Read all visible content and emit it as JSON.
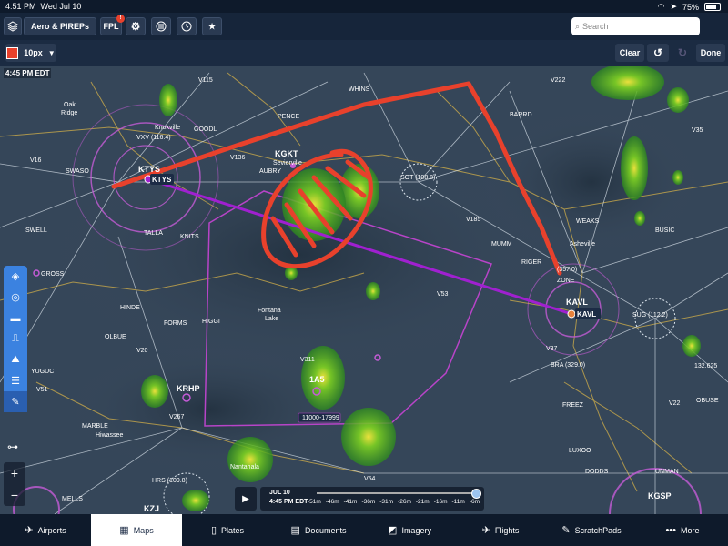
{
  "status": {
    "time": "4:51 PM",
    "date": "Wed Jul 10",
    "battery": "75%",
    "wifi_icon": "wifi-icon",
    "location_icon": "location-arrow-icon",
    "battery_icon": "battery-icon"
  },
  "toolbar": {
    "layers_icon": "layers-icon",
    "layer_selector": "Aero & PIREPs",
    "fpl_label": "FPL",
    "fpl_badge": "!",
    "settings_icon": "gear-icon",
    "wind_icon": "compass-icon",
    "timer_icon": "clock-icon",
    "favorites_icon": "star-clock-icon",
    "search_placeholder": "Search",
    "search_icon": "search-icon"
  },
  "drawing": {
    "stroke_size": "10px",
    "color": "#e8412c",
    "clear": "Clear",
    "undo_icon": "undo-icon",
    "redo_icon": "redo-icon",
    "done": "Done"
  },
  "map": {
    "time_label": "4:45 PM EDT",
    "labels": {
      "oak_ridge_1": "Oak",
      "oak_ridge_2": "Ridge",
      "knoxville": "Knoxville",
      "vxv": "VXV (116.4)",
      "goodl": "GOODL",
      "whins": "WHINS",
      "pence": "PENCE",
      "kgkt": "KGKT",
      "sevierville": "Sevierville",
      "aubry": "AUBRY",
      "barrd": "BARRD",
      "swaso": "SWASO",
      "ktys_label": "KTYS",
      "ktys_route": "KTYS",
      "sot": "SOT (108.8)",
      "swell": "SWELL",
      "talla": "TALLA",
      "knits": "KNITS",
      "weaks": "WEAKS",
      "mumm": "MUMM",
      "busic": "BUSIC",
      "asheville": "Asheville",
      "avl_vor": "(357.0)",
      "zone": "ZONE",
      "kavl_label": "KAVL",
      "kavl_route": "KAVL",
      "sug": "SUG (112.2)",
      "gross": "GROSS",
      "hinde": "HINDE",
      "forms": "FORMS",
      "higgi": "HIGGI",
      "fontana": "Fontana",
      "lake": "Lake",
      "olbue": "OLBUE",
      "yuguc": "YUGUC",
      "krhp": "KRHP",
      "one_as": "1A5",
      "altitude": "11000-17999",
      "bra": "BRA (329.0)",
      "freez": "FREEZ",
      "marble": "MARBLE",
      "hiwassee": "Hiwassee",
      "nantahala": "Nantahala",
      "hrs": "HRS (109.8)",
      "mells": "MELLS",
      "kzi": "KZJ",
      "luxoo": "LUXOO",
      "dodds": "DODDS",
      "unman": "UNMAN",
      "kgsp": "KGSP",
      "obuse": "OBUSE",
      "freq": "132.625",
      "riger": "RIGER",
      "v16": "V16",
      "v136": "V136",
      "v185": "V185",
      "v54": "V54",
      "v35": "V35",
      "v53": "V53",
      "v115": "V115",
      "v267": "V267",
      "v22": "V22",
      "v222": "V222",
      "v311": "V311",
      "v37": "V37",
      "v51": "V51",
      "v20": "V20"
    }
  },
  "left_tools": [
    {
      "name": "waypoint-tool",
      "icon": "◈"
    },
    {
      "name": "route-tool",
      "icon": "◎"
    },
    {
      "name": "runway-tool",
      "icon": "▬"
    },
    {
      "name": "profile-tool",
      "icon": "⎍"
    },
    {
      "name": "terrain-tool",
      "icon": "⛰"
    },
    {
      "name": "list-tool",
      "icon": "☰"
    },
    {
      "name": "pen-tool",
      "icon": "✎"
    }
  ],
  "zoom": {
    "in": "+",
    "out": "−"
  },
  "timeline": {
    "date": "JUL 10",
    "time": "4:45 PM EDT",
    "ticks": [
      "-51m",
      "-46m",
      "-41m",
      "-36m",
      "-31m",
      "-26m",
      "-21m",
      "-16m",
      "-11m",
      "-6m"
    ],
    "play_icon": "play-icon"
  },
  "tabs": [
    {
      "label": "Airports",
      "icon": "✈"
    },
    {
      "label": "Maps",
      "icon": "▦"
    },
    {
      "label": "Plates",
      "icon": "▯"
    },
    {
      "label": "Documents",
      "icon": "▤"
    },
    {
      "label": "Imagery",
      "icon": "◩"
    },
    {
      "label": "Flights",
      "icon": "✈"
    },
    {
      "label": "ScratchPads",
      "icon": "✎"
    },
    {
      "label": "More",
      "icon": "•••"
    }
  ]
}
